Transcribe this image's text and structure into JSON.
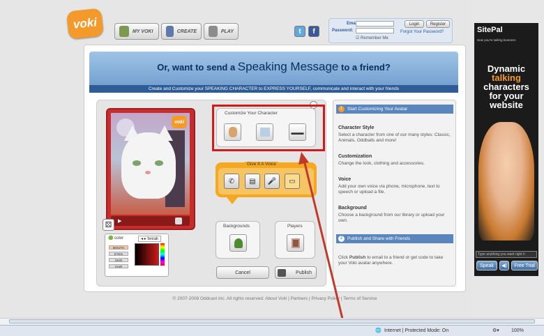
{
  "header": {
    "logo": "voki",
    "nav": [
      {
        "label": "MY VOKI"
      },
      {
        "label": "CREATE"
      },
      {
        "label": "PLAY"
      }
    ],
    "login": {
      "email_label": "Email:",
      "password_label": "Password:",
      "remember": "Remember Me",
      "login_btn": "Login",
      "register_btn": "Register",
      "forgot": "Forgot Your Password?"
    }
  },
  "banner": {
    "title_pre": "Or, want to send a",
    "title_big": "Speaking Message",
    "title_post": "to a friend?",
    "subtitle": "Create and Customize your SPEAKING CHARACTER to EXPRESS YOURSELF, communicate and interact with your friends"
  },
  "editor": {
    "stage_logo": "voki",
    "color_tab": "color",
    "tweak_tab": "tweak",
    "parts": [
      "MOUTH",
      "EYES",
      "SKIN",
      "HAIR"
    ],
    "customize_label": "Customize Your Character",
    "voice_label": "Give It A Voice",
    "backgrounds_label": "Backgrounds",
    "players_label": "Players",
    "cancel": "Cancel",
    "publish": "Publish"
  },
  "info": {
    "step1": {
      "num": "1",
      "title": "Start Customizing Your Avatar"
    },
    "sections": [
      {
        "title": "Character Style",
        "text": "Select a character from one of our many styles: Classic, Animals, Oddballs and more!"
      },
      {
        "title": "Customization",
        "text": "Change the look, clothing and accessories."
      },
      {
        "title": "Voice",
        "text": "Add your own voice via phone, microphone, text to speech or upload a file."
      },
      {
        "title": "Background",
        "text": "Choose a background from our library or upload your own."
      }
    ],
    "step2": {
      "num": "2",
      "title": "Publish and Share with Friends"
    },
    "publish_pre": "Click",
    "publish_bold": "Publish",
    "publish_post": "to email to a friend or get code to take your Voki avatar anywhere."
  },
  "footer": "© 2007-2008 Oddcast Inc. All rights reserved.   About Voki   |   Partners   |   Privacy Policy   |   Terms of Service",
  "ad": {
    "brand": "SitePal",
    "tagline": "Now you're talking business",
    "headline_1": "Dynamic",
    "headline_2": "talking",
    "headline_3": "characters",
    "headline_4": "for your",
    "headline_5": "website",
    "input_placeholder": "Type anything you want right h",
    "speak": "Speak",
    "free_trial": "Free Trial"
  },
  "status": {
    "zone": "Internet | Protected Mode: On",
    "zoom": "100%"
  },
  "colors": {
    "accent_orange": "#f39a2a",
    "highlight_red": "#d21a1a",
    "banner_blue": "#2d5c98"
  }
}
